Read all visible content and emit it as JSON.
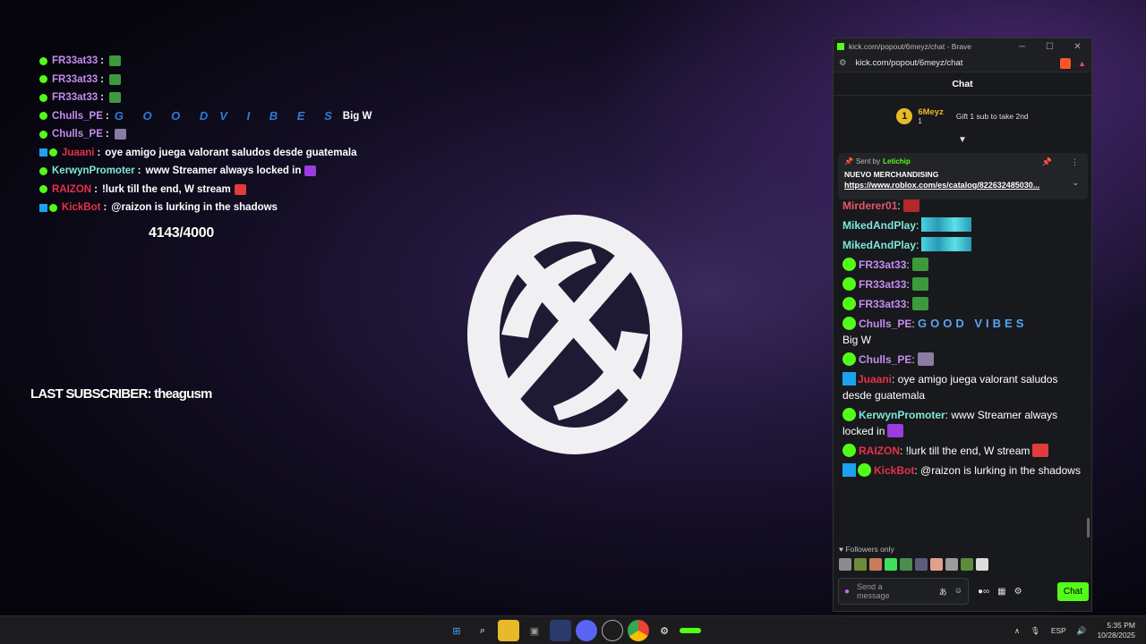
{
  "overlay": {
    "lines": [
      {
        "name": "FR33at33",
        "name_color": "#c48cf0",
        "badge": "verified",
        "msg": "",
        "emote": "#3c9a3c"
      },
      {
        "name": "FR33at33",
        "name_color": "#c48cf0",
        "badge": "verified",
        "msg": "",
        "emote": "#3c9a3c"
      },
      {
        "name": "FR33at33",
        "name_color": "#c48cf0",
        "badge": "verified",
        "msg": "",
        "emote": "#3c9a3c"
      },
      {
        "name": "Chulls_PE",
        "name_color": "#c48cf0",
        "badge": "verified",
        "msg": "Big W",
        "emote": ""
      },
      {
        "name": "Chulls_PE",
        "name_color": "#c48cf0",
        "badge": "verified",
        "msg": "",
        "emote": "#8c7ca4"
      },
      {
        "name": "Juaani",
        "name_color": "#e8304a",
        "badge": "box",
        "msg": "oye amigo juega valorant saludos desde guatemala",
        "emote": ""
      },
      {
        "name": "KerwynPromoter",
        "name_color": "#7fe8d8",
        "badge": "verified",
        "msg": "www Streamer always locked in",
        "emote": "#9a3ce0"
      },
      {
        "name": "RAIZON",
        "name_color": "#e8304a",
        "badge": "verified",
        "msg": "!lurk till the end,  W  stream",
        "emote": "#e03c3c"
      },
      {
        "name": "KickBot",
        "name_color": "#e8304a",
        "badge": "box",
        "msg": "@raizon is lurking in the shadows",
        "emote": ""
      }
    ],
    "good_vibes": "G O O D",
    "vibes": "V I B E S",
    "counter": "4143/4000",
    "last_subscriber": "LAST SUBSCRIBER: theagusm"
  },
  "browser": {
    "title": "kick.com/popout/6meyz/chat - Brave",
    "url": "kick.com/popout/6meyz/chat",
    "minimize": "─",
    "maximize": "☐",
    "close": "✕"
  },
  "chat": {
    "header": "Chat",
    "top_gifter": {
      "rank": "1",
      "name": "6Meyz",
      "count": "1",
      "cta": "Gift 1 sub to take 2nd"
    },
    "pinned": {
      "sent_by": "Sent by",
      "user": "Letichip",
      "title": "NUEVO MERCHANDISING",
      "link": "https://www.roblox.com/es/catalog/822632485030..."
    },
    "messages": [
      {
        "name": "Mirderer01",
        "color": "#e8576a",
        "badge": false,
        "text": ":",
        "emote": "#b02a2a"
      },
      {
        "name": "MikedAndPlay",
        "color": "#7fe8d8",
        "badge": false,
        "text": ":",
        "waves": true
      },
      {
        "name": "MikedAndPlay",
        "color": "#7fe8d8",
        "badge": false,
        "text": ":",
        "waves": true
      },
      {
        "name": "FR33at33",
        "color": "#c48cf0",
        "badge": true,
        "text": ":",
        "emote": "#3c9a3c"
      },
      {
        "name": "FR33at33",
        "color": "#c48cf0",
        "badge": true,
        "text": ":",
        "emote": "#3c9a3c"
      },
      {
        "name": "FR33at33",
        "color": "#c48cf0",
        "badge": true,
        "text": ":",
        "emote": "#3c9a3c"
      },
      {
        "name": "Chulls_PE",
        "color": "#c48cf0",
        "badge": true,
        "text": ": ",
        "gv": "GOOD VIBES",
        "after": "Big W"
      },
      {
        "name": "Chulls_PE",
        "color": "#c48cf0",
        "badge": true,
        "text": ":",
        "emote": "#8c7ca4"
      },
      {
        "name": "Juaani",
        "color": "#e8304a",
        "badge": false,
        "box": true,
        "text": ": oye amigo juega valorant saludos desde guatemala"
      },
      {
        "name": "KerwynPromoter",
        "color": "#7fe8d8",
        "badge": true,
        "text": ": www Streamer always locked in",
        "emote": "#9a3ce0"
      },
      {
        "name": "RAIZON",
        "color": "#e8304a",
        "badge": true,
        "text": ": !lurk till the end, W stream",
        "emote": "#e03c3c"
      },
      {
        "name": "KickBot",
        "color": "#e8304a",
        "badge": true,
        "box": true,
        "text": ": @raizon is lurking in the shadows"
      }
    ],
    "followers_only": "Followers only",
    "input_placeholder": "Send a message",
    "send_button": "Chat"
  },
  "taskbar": {
    "language": "ESP",
    "time": "5:35 PM",
    "date": "10/28/2025"
  }
}
